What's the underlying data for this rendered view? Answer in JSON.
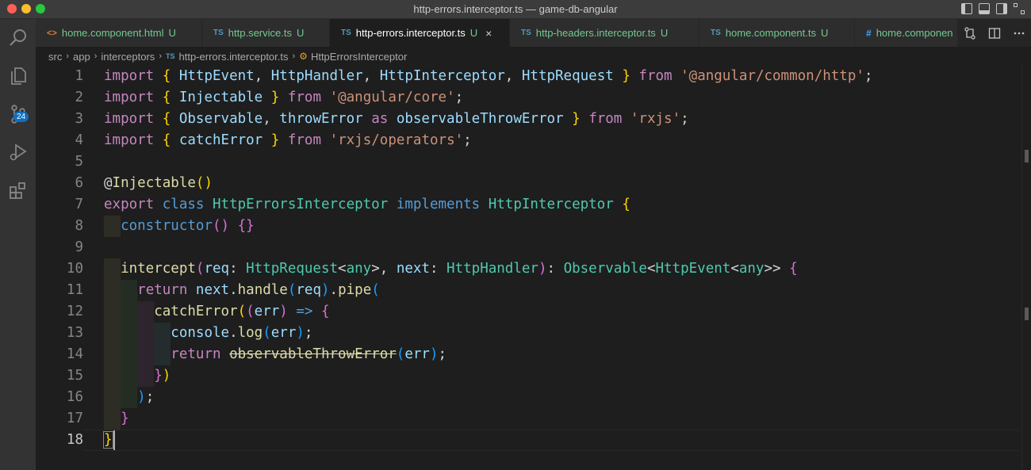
{
  "window": {
    "title": "http-errors.interceptor.ts — game-db-angular"
  },
  "activity_bar": {
    "source_control_badge": "24"
  },
  "tabs": [
    {
      "icon": "<>",
      "label": "home.component.html",
      "status": "U",
      "active": false
    },
    {
      "icon": "TS",
      "label": "http.service.ts",
      "status": "U",
      "active": false
    },
    {
      "icon": "TS",
      "label": "http-errors.interceptor.ts",
      "status": "U",
      "active": true,
      "close": "×"
    },
    {
      "icon": "TS",
      "label": "http-headers.interceptor.ts",
      "status": "U",
      "active": false
    },
    {
      "icon": "TS",
      "label": "home.component.ts",
      "status": "U",
      "active": false
    },
    {
      "icon": "#",
      "label": "home.componen",
      "status": "",
      "active": false
    }
  ],
  "breadcrumb": {
    "items": [
      "src",
      "app",
      "interceptors",
      "http-errors.interceptor.ts",
      "HttpErrorsInterceptor"
    ],
    "file_icon": "TS"
  },
  "editor": {
    "line_numbers": [
      "1",
      "2",
      "3",
      "4",
      "5",
      "6",
      "7",
      "8",
      "9",
      "10",
      "11",
      "12",
      "13",
      "14",
      "15",
      "16",
      "17",
      "18"
    ],
    "current_line": 18,
    "lines": [
      [
        [
          "k",
          "import"
        ],
        [
          "p",
          " "
        ],
        [
          "b1",
          "{"
        ],
        [
          "p",
          " "
        ],
        [
          "v",
          "HttpEvent"
        ],
        [
          "p",
          ", "
        ],
        [
          "v",
          "HttpHandler"
        ],
        [
          "p",
          ", "
        ],
        [
          "v",
          "HttpInterceptor"
        ],
        [
          "p",
          ", "
        ],
        [
          "v",
          "HttpRequest"
        ],
        [
          "p",
          " "
        ],
        [
          "b1",
          "}"
        ],
        [
          "p",
          " "
        ],
        [
          "k",
          "from"
        ],
        [
          "p",
          " "
        ],
        [
          "s",
          "'@angular/common/http'"
        ],
        [
          "p",
          ";"
        ]
      ],
      [
        [
          "k",
          "import"
        ],
        [
          "p",
          " "
        ],
        [
          "b1",
          "{"
        ],
        [
          "p",
          " "
        ],
        [
          "v",
          "Injectable"
        ],
        [
          "p",
          " "
        ],
        [
          "b1",
          "}"
        ],
        [
          "p",
          " "
        ],
        [
          "k",
          "from"
        ],
        [
          "p",
          " "
        ],
        [
          "s",
          "'@angular/core'"
        ],
        [
          "p",
          ";"
        ]
      ],
      [
        [
          "k",
          "import"
        ],
        [
          "p",
          " "
        ],
        [
          "b1",
          "{"
        ],
        [
          "p",
          " "
        ],
        [
          "v",
          "Observable"
        ],
        [
          "p",
          ", "
        ],
        [
          "v",
          "throwError"
        ],
        [
          "p",
          " "
        ],
        [
          "k",
          "as"
        ],
        [
          "p",
          " "
        ],
        [
          "v",
          "observableThrowError"
        ],
        [
          "p",
          " "
        ],
        [
          "b1",
          "}"
        ],
        [
          "p",
          " "
        ],
        [
          "k",
          "from"
        ],
        [
          "p",
          " "
        ],
        [
          "s",
          "'rxjs'"
        ],
        [
          "p",
          ";"
        ]
      ],
      [
        [
          "k",
          "import"
        ],
        [
          "p",
          " "
        ],
        [
          "b1",
          "{"
        ],
        [
          "p",
          " "
        ],
        [
          "v",
          "catchError"
        ],
        [
          "p",
          " "
        ],
        [
          "b1",
          "}"
        ],
        [
          "p",
          " "
        ],
        [
          "k",
          "from"
        ],
        [
          "p",
          " "
        ],
        [
          "s",
          "'rxjs/operators'"
        ],
        [
          "p",
          ";"
        ]
      ],
      [],
      [
        [
          "p",
          "@"
        ],
        [
          "f",
          "Injectable"
        ],
        [
          "b1",
          "()"
        ]
      ],
      [
        [
          "k",
          "export"
        ],
        [
          "p",
          " "
        ],
        [
          "kb",
          "class"
        ],
        [
          "p",
          " "
        ],
        [
          "t",
          "HttpErrorsInterceptor"
        ],
        [
          "p",
          " "
        ],
        [
          "kb",
          "implements"
        ],
        [
          "p",
          " "
        ],
        [
          "t",
          "HttpInterceptor"
        ],
        [
          "p",
          " "
        ],
        [
          "b1",
          "{"
        ]
      ],
      [
        [
          "p",
          "  "
        ],
        [
          "kb",
          "constructor"
        ],
        [
          "b2",
          "()"
        ],
        [
          "p",
          " "
        ],
        [
          "b2",
          "{}"
        ]
      ],
      [],
      [
        [
          "p",
          "  "
        ],
        [
          "f",
          "intercept"
        ],
        [
          "b2",
          "("
        ],
        [
          "v",
          "req"
        ],
        [
          "p",
          ": "
        ],
        [
          "t",
          "HttpRequest"
        ],
        [
          "p",
          "<"
        ],
        [
          "t",
          "any"
        ],
        [
          "p",
          ">, "
        ],
        [
          "v",
          "next"
        ],
        [
          "p",
          ": "
        ],
        [
          "t",
          "HttpHandler"
        ],
        [
          "b2",
          ")"
        ],
        [
          "p",
          ": "
        ],
        [
          "t",
          "Observable"
        ],
        [
          "p",
          "<"
        ],
        [
          "t",
          "HttpEvent"
        ],
        [
          "p",
          "<"
        ],
        [
          "t",
          "any"
        ],
        [
          "p",
          ">> "
        ],
        [
          "b2",
          "{"
        ]
      ],
      [
        [
          "p",
          "    "
        ],
        [
          "k",
          "return"
        ],
        [
          "p",
          " "
        ],
        [
          "v",
          "next"
        ],
        [
          "p",
          "."
        ],
        [
          "f",
          "handle"
        ],
        [
          "b3",
          "("
        ],
        [
          "v",
          "req"
        ],
        [
          "b3",
          ")"
        ],
        [
          "p",
          "."
        ],
        [
          "f",
          "pipe"
        ],
        [
          "b3",
          "("
        ]
      ],
      [
        [
          "p",
          "      "
        ],
        [
          "f",
          "catchError"
        ],
        [
          "b1",
          "("
        ],
        [
          "b2",
          "("
        ],
        [
          "v",
          "err"
        ],
        [
          "b2",
          ")"
        ],
        [
          "p",
          " "
        ],
        [
          "kb",
          "=>"
        ],
        [
          "p",
          " "
        ],
        [
          "b2",
          "{"
        ]
      ],
      [
        [
          "p",
          "        "
        ],
        [
          "v",
          "console"
        ],
        [
          "p",
          "."
        ],
        [
          "f",
          "log"
        ],
        [
          "b3",
          "("
        ],
        [
          "v",
          "err"
        ],
        [
          "b3",
          ")"
        ],
        [
          "p",
          ";"
        ]
      ],
      [
        [
          "p",
          "        "
        ],
        [
          "k",
          "return"
        ],
        [
          "p",
          " "
        ],
        [
          "fs",
          "observableThrowError"
        ],
        [
          "b3",
          "("
        ],
        [
          "v",
          "err"
        ],
        [
          "b3",
          ")"
        ],
        [
          "p",
          ";"
        ]
      ],
      [
        [
          "p",
          "      "
        ],
        [
          "b2",
          "}"
        ],
        [
          "b1",
          ")"
        ]
      ],
      [
        [
          "p",
          "    "
        ],
        [
          "b3",
          ")"
        ],
        [
          "p",
          ";"
        ]
      ],
      [
        [
          "p",
          "  "
        ],
        [
          "b2",
          "}"
        ]
      ],
      [
        [
          "bm",
          "}"
        ]
      ]
    ]
  },
  "colors": {
    "background": "#1e1e1e",
    "activity_bar": "#333333",
    "tab_bar": "#252526",
    "badge": "#0e70c0"
  }
}
